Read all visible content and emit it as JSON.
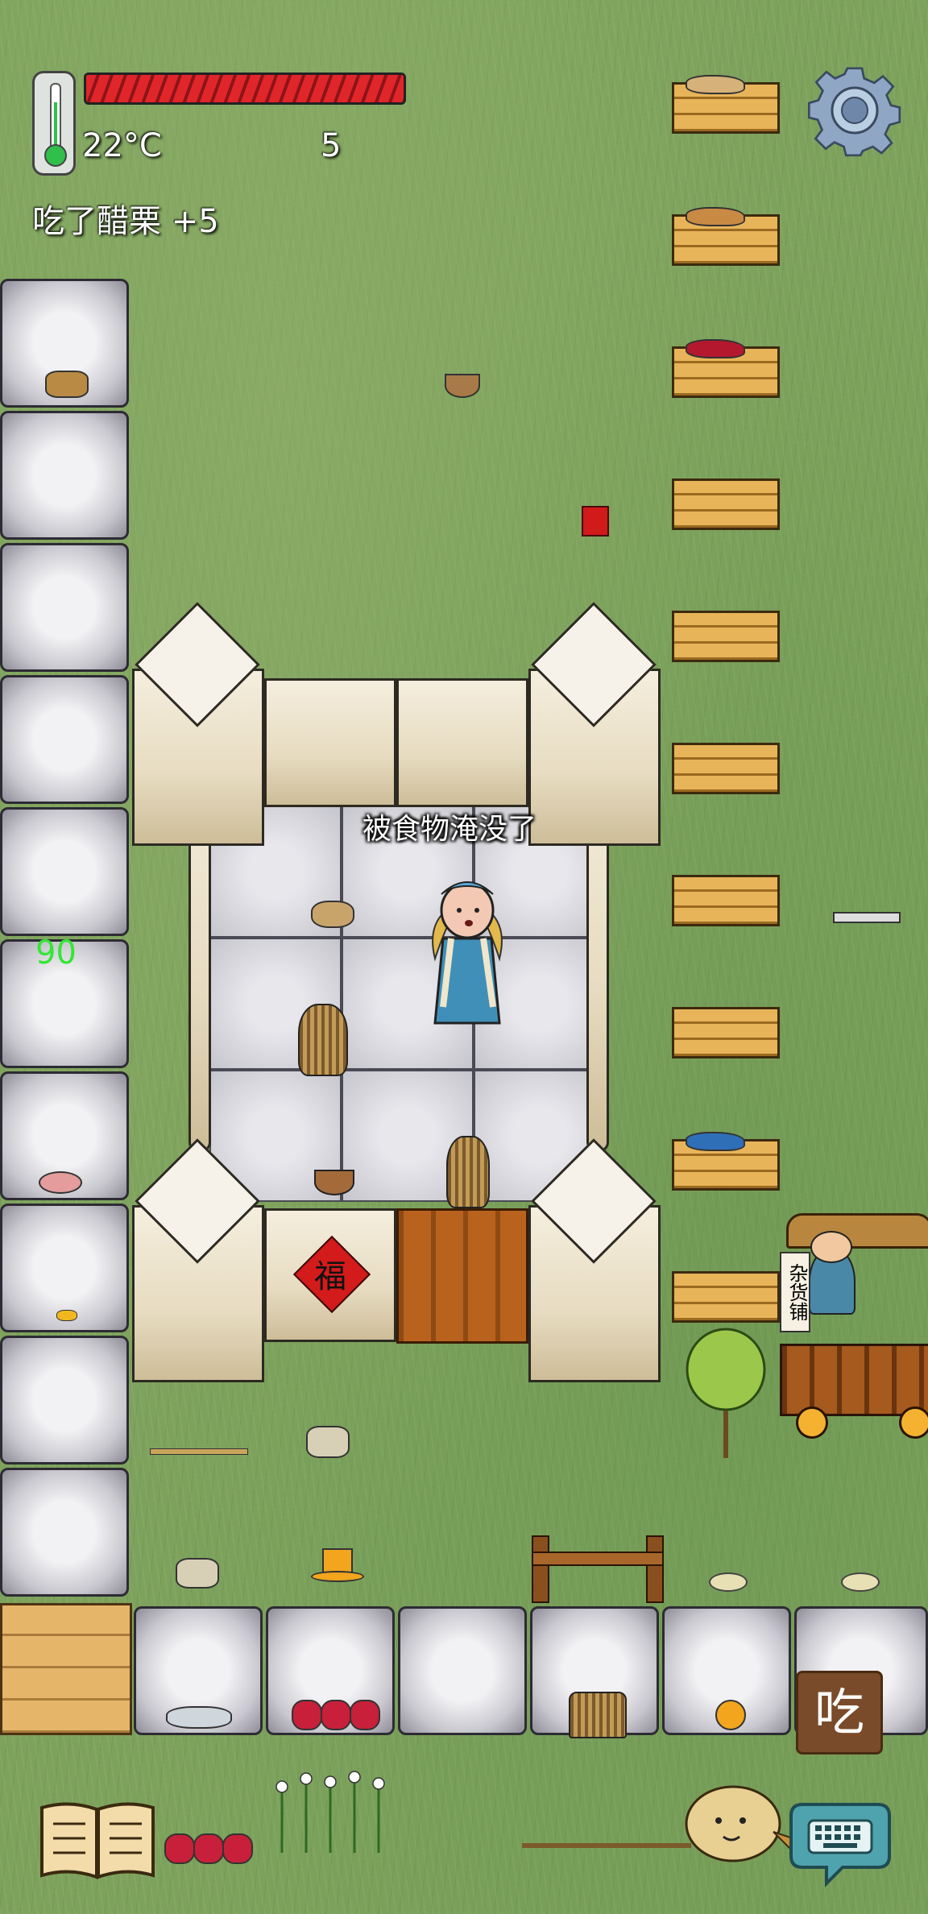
{
  "hud": {
    "temperature": "22°C",
    "hunger_value": "5",
    "status_message": "吃了醋栗 +5",
    "health_fraction": 1.0,
    "temperature_color": "#2fbf4a"
  },
  "world": {
    "player_speech": "被食物淹没了",
    "age_label": "90",
    "age_label_color": "#33e633",
    "door_sign": "福",
    "shop_sign": "杂货铺",
    "crates": [
      {
        "content": "bread"
      },
      {
        "content": "baked-goods"
      },
      {
        "content": "red-berries"
      },
      {
        "content": "empty"
      },
      {
        "content": "empty"
      },
      {
        "content": "empty"
      },
      {
        "content": "empty"
      },
      {
        "content": "empty"
      },
      {
        "content": "blue-cloth"
      },
      {
        "content": "empty"
      }
    ]
  },
  "controls": {
    "eat_label": "吃",
    "settings_icon": "gear-icon",
    "journal_icon": "book-icon",
    "chat_icon": "keyboard-icon",
    "emote_icon": "potato-face-icon"
  }
}
